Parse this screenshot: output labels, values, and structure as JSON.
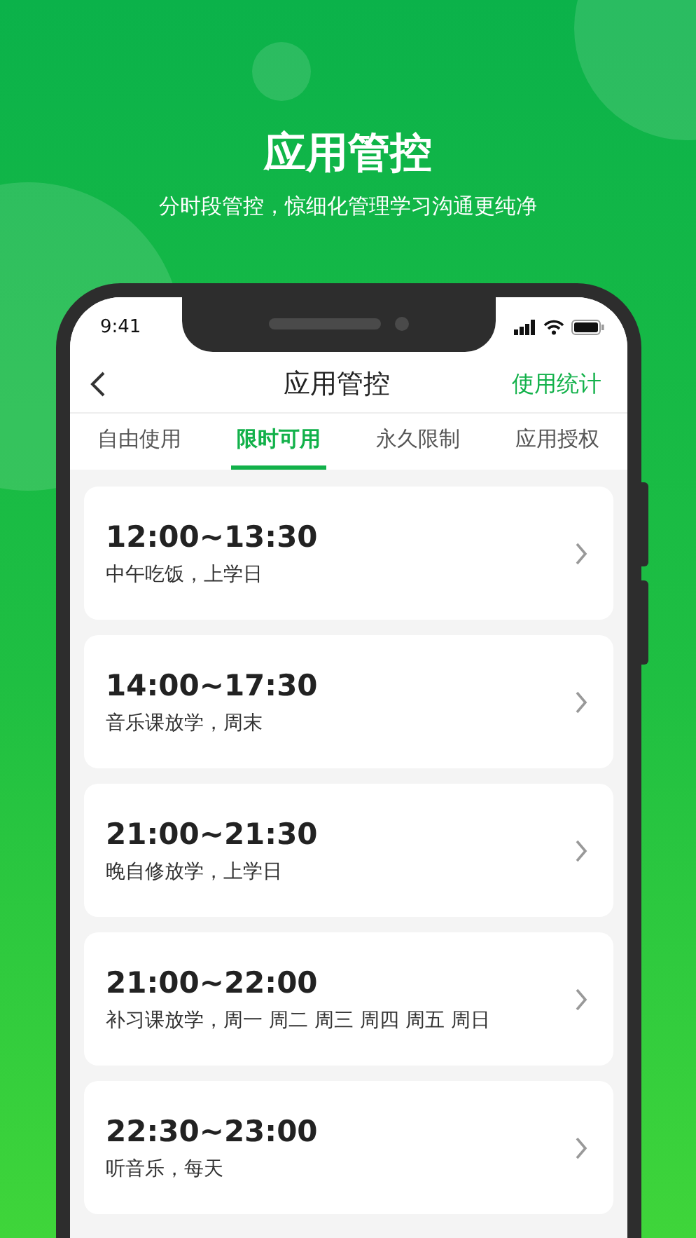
{
  "header": {
    "title": "应用管控",
    "subtitle": "分时段管控，惊细化管理学习沟通更纯净"
  },
  "status_bar": {
    "time": "9:41"
  },
  "nav_bar": {
    "title": "应用管控",
    "action": "使用统计"
  },
  "tabs": [
    {
      "label": "自由使用",
      "selected": false
    },
    {
      "label": "限时可用",
      "selected": true
    },
    {
      "label": "永久限制",
      "selected": false
    },
    {
      "label": "应用授权",
      "selected": false
    }
  ],
  "schedules": [
    {
      "time": "12:00~13:30",
      "note": "中午吃饭，上学日"
    },
    {
      "time": "14:00~17:30",
      "note": "音乐课放学，周末"
    },
    {
      "time": "21:00~21:30",
      "note": "晚自修放学，上学日"
    },
    {
      "time": "21:00~22:00",
      "note": "补习课放学，周一 周二 周三 周四 周五 周日"
    },
    {
      "time": "22:30~23:00",
      "note": "听音乐，每天"
    }
  ]
}
